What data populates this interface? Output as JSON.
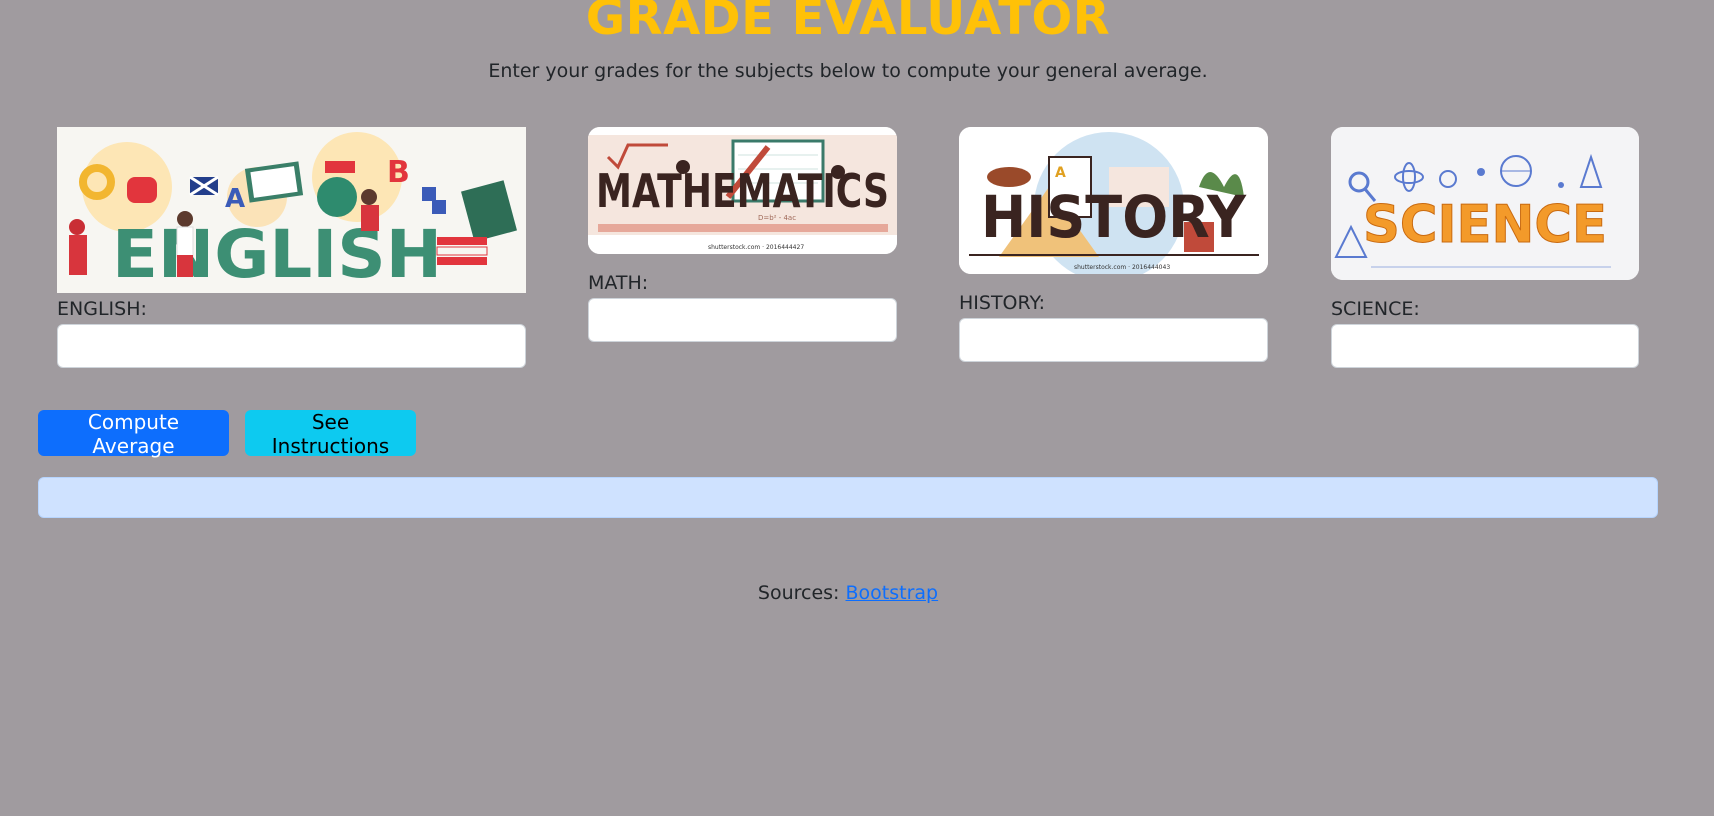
{
  "header": {
    "title": "GRADE EVALUATOR",
    "subtitle": "Enter your grades for the subjects below to compute your general average."
  },
  "subjects": [
    {
      "banner_text": "ENGLISH",
      "label": "ENGLISH:",
      "value": "",
      "image": "english-banner-image"
    },
    {
      "banner_text": "MATHEMATICS",
      "label": "MATH:",
      "value": "",
      "image": "mathematics-banner-image",
      "stock_caption": "shutterstock.com · 2016444427",
      "formula": "D=b² - 4ac"
    },
    {
      "banner_text": "HISTORY",
      "label": "HISTORY:",
      "value": "",
      "image": "history-banner-image",
      "stock_caption": "shutterstock.com · 2016444043"
    },
    {
      "banner_text": "SCIENCE",
      "label": "SCIENCE:",
      "value": "",
      "image": "science-banner-image"
    }
  ],
  "actions": {
    "compute_label": "Compute Average",
    "instructions_label": "See Instructions"
  },
  "result": {
    "text": ""
  },
  "footer": {
    "sources_prefix": "Sources:",
    "link_text": "Bootstrap"
  },
  "colors": {
    "background": "#a09b9f",
    "title": "#ffc107",
    "primary": "#0d6efd",
    "info": "#0dcaf0",
    "result_bg": "#cfe2ff"
  }
}
